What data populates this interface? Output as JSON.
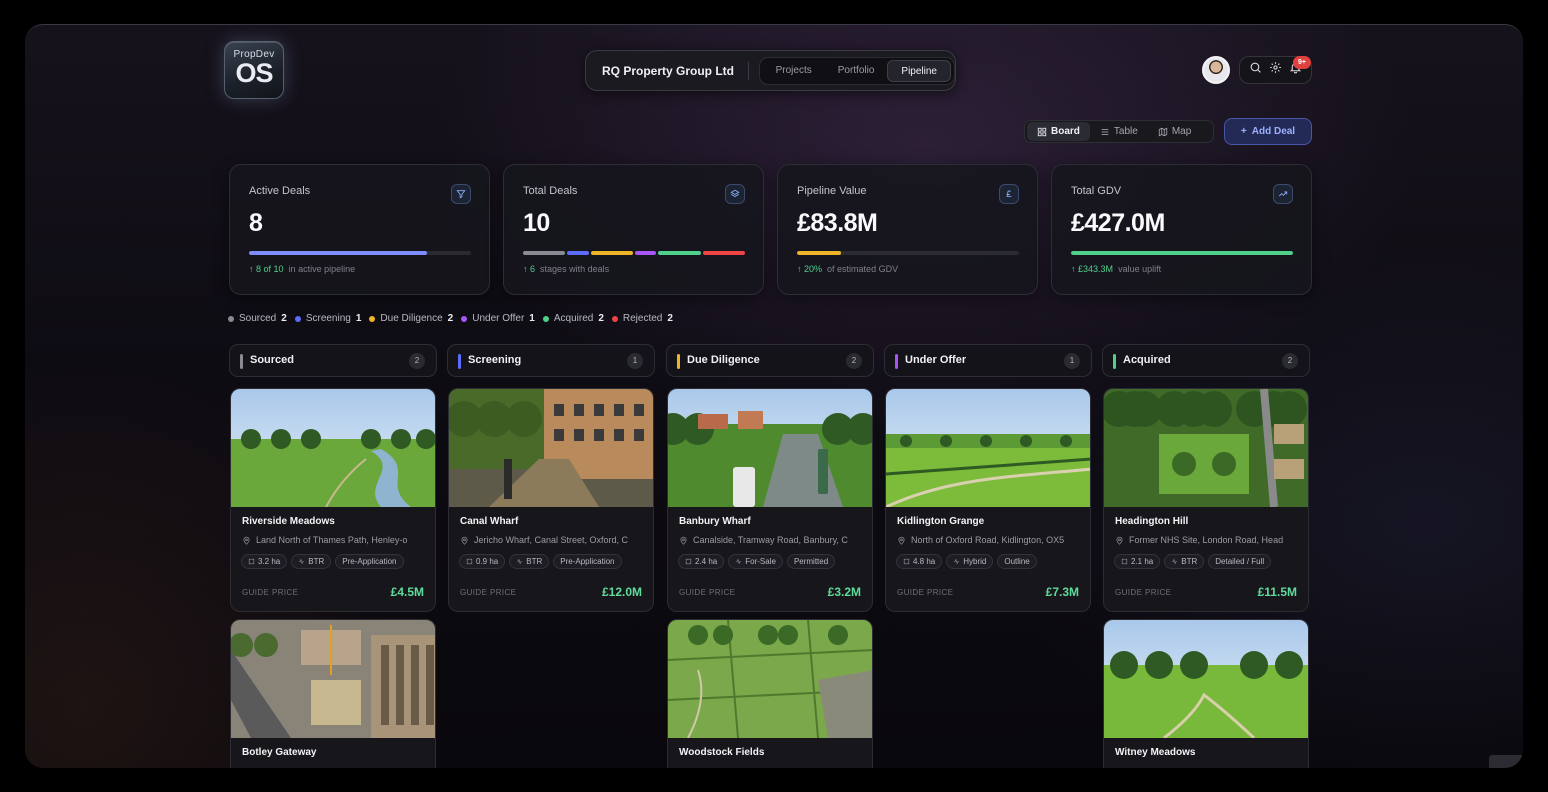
{
  "brand": {
    "line1": "PropDev",
    "line2": "OS"
  },
  "header": {
    "company": "RQ Property Group Ltd",
    "tabs": [
      {
        "label": "Projects",
        "active": false
      },
      {
        "label": "Portfolio",
        "active": false
      },
      {
        "label": "Pipeline",
        "active": true
      }
    ],
    "notifications_badge": "9+",
    "icons": [
      "search-icon",
      "gear-icon",
      "bell-icon"
    ]
  },
  "toolbar": {
    "views": [
      {
        "label": "Board",
        "icon": "grid-icon",
        "active": true
      },
      {
        "label": "Table",
        "icon": "list-icon",
        "active": false
      },
      {
        "label": "Map",
        "icon": "map-icon",
        "active": false
      }
    ],
    "add_deal": "Add Deal"
  },
  "stats": [
    {
      "label": "Active Deals",
      "value": "8",
      "icon": "filter-icon",
      "progress": 0.8,
      "bar_color": "#7d8cff",
      "foot_highlight": "8 of 10",
      "foot_text": "in active pipeline"
    },
    {
      "label": "Total Deals",
      "value": "10",
      "icon": "layers-icon",
      "foot_highlight": "6",
      "foot_text": "stages with deals",
      "segments": [
        {
          "color": "#8a8a92",
          "share": 2
        },
        {
          "color": "#5b6cff",
          "share": 1
        },
        {
          "color": "#f0b429",
          "share": 2
        },
        {
          "color": "#a855f7",
          "share": 1
        },
        {
          "color": "#4fd18b",
          "share": 2
        },
        {
          "color": "#ef4444",
          "share": 2
        }
      ]
    },
    {
      "label": "Pipeline Value",
      "value": "£83.8M",
      "icon": "pound-icon",
      "progress": 0.2,
      "bar_color": "#f0b429",
      "foot_highlight": "20%",
      "foot_text": "of estimated GDV"
    },
    {
      "label": "Total GDV",
      "value": "£427.0M",
      "icon": "trend-up-icon",
      "progress": 1.0,
      "bar_color": "#4fd18b",
      "foot_highlight": "£343.3M",
      "foot_text": "value uplift"
    }
  ],
  "legend": [
    {
      "label": "Sourced",
      "count": "2",
      "color": "#8a8a92"
    },
    {
      "label": "Screening",
      "count": "1",
      "color": "#5b6cff"
    },
    {
      "label": "Due Diligence",
      "count": "2",
      "color": "#f0b429"
    },
    {
      "label": "Under Offer",
      "count": "1",
      "color": "#a855f7"
    },
    {
      "label": "Acquired",
      "count": "2",
      "color": "#4fd18b"
    },
    {
      "label": "Rejected",
      "count": "2",
      "color": "#ef4444"
    }
  ],
  "columns": [
    {
      "name": "Sourced",
      "count": "2",
      "color": "#8a8a92"
    },
    {
      "name": "Screening",
      "count": "1",
      "color": "#5b6cff"
    },
    {
      "name": "Due Diligence",
      "count": "2",
      "color": "#f0b429"
    },
    {
      "name": "Under Offer",
      "count": "1",
      "color": "#a855f7"
    },
    {
      "name": "Acquired",
      "count": "2",
      "color": "#4fd18b"
    }
  ],
  "cards": [
    {
      "column": 0,
      "row": 0,
      "scene": "river",
      "title": "Riverside Meadows",
      "address": "Land North of Thames Path, Henley-o",
      "tags": [
        "3.2 ha",
        "BTR",
        "Pre-Application"
      ],
      "price_label": "GUIDE PRICE",
      "price": "£4.5M"
    },
    {
      "column": 1,
      "row": 0,
      "scene": "canal",
      "title": "Canal Wharf",
      "address": "Jericho Wharf, Canal Street, Oxford, C",
      "tags": [
        "0.9 ha",
        "BTR",
        "Pre-Application"
      ],
      "price_label": "GUIDE PRICE",
      "price": "£12.0M"
    },
    {
      "column": 2,
      "row": 0,
      "scene": "boats",
      "title": "Banbury Wharf",
      "address": "Canalside, Tramway Road, Banbury, C",
      "tags": [
        "2.4 ha",
        "For-Sale",
        "Permitted"
      ],
      "price_label": "GUIDE PRICE",
      "price": "£3.2M"
    },
    {
      "column": 3,
      "row": 0,
      "scene": "fields",
      "title": "Kidlington Grange",
      "address": "North of Oxford Road, Kidlington, OX5",
      "tags": [
        "4.8 ha",
        "Hybrid",
        "Outline"
      ],
      "price_label": "GUIDE PRICE",
      "price": "£7.3M"
    },
    {
      "column": 4,
      "row": 0,
      "scene": "village",
      "title": "Headington Hill",
      "address": "Former NHS Site, London Road, Head",
      "tags": [
        "2.1 ha",
        "BTR",
        "Detailed / Full"
      ],
      "price_label": "GUIDE PRICE",
      "price": "£11.5M"
    },
    {
      "column": 0,
      "row": 1,
      "scene": "construction",
      "title": "Botley Gateway"
    },
    {
      "column": 2,
      "row": 1,
      "scene": "aerial",
      "title": "Woodstock Fields"
    },
    {
      "column": 4,
      "row": 1,
      "scene": "meadow",
      "title": "Witney Meadows"
    }
  ]
}
